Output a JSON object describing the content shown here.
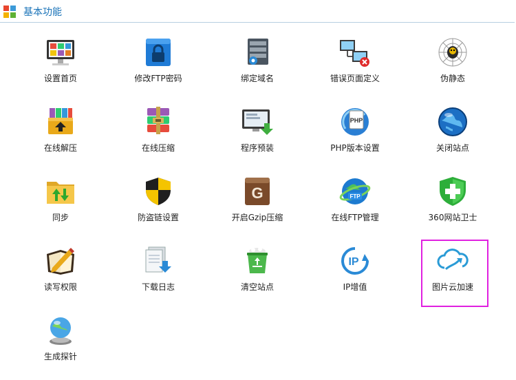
{
  "section": {
    "title": "基本功能"
  },
  "items": [
    {
      "label": "设置首页",
      "icon": "monitor-icon"
    },
    {
      "label": "修改FTP密码",
      "icon": "lock-icon"
    },
    {
      "label": "绑定域名",
      "icon": "server-icon"
    },
    {
      "label": "错误页面定义",
      "icon": "network-error-icon"
    },
    {
      "label": "伪静态",
      "icon": "spider-web-icon"
    },
    {
      "label": "在线解压",
      "icon": "archive-extract-icon"
    },
    {
      "label": "在线压缩",
      "icon": "archive-compress-icon"
    },
    {
      "label": "程序预装",
      "icon": "monitor-download-icon"
    },
    {
      "label": "PHP版本设置",
      "icon": "php-icon"
    },
    {
      "label": "关闭站点",
      "icon": "globe-icon"
    },
    {
      "label": "同步",
      "icon": "folder-sync-icon"
    },
    {
      "label": "防盗链设置",
      "icon": "shield-icon"
    },
    {
      "label": "开启Gzip压缩",
      "icon": "gzip-icon"
    },
    {
      "label": "在线FTP管理",
      "icon": "ftp-globe-icon"
    },
    {
      "label": "360网站卫士",
      "icon": "green-shield-plus-icon"
    },
    {
      "label": "读写权限",
      "icon": "notebook-pen-icon"
    },
    {
      "label": "下载日志",
      "icon": "document-download-icon"
    },
    {
      "label": "清空站点",
      "icon": "recycle-bin-icon"
    },
    {
      "label": "IP增值",
      "icon": "ip-icon"
    },
    {
      "label": "图片云加速",
      "icon": "cloud-arrow-icon"
    },
    {
      "label": "生成探针",
      "icon": "globe-probe-icon"
    }
  ]
}
